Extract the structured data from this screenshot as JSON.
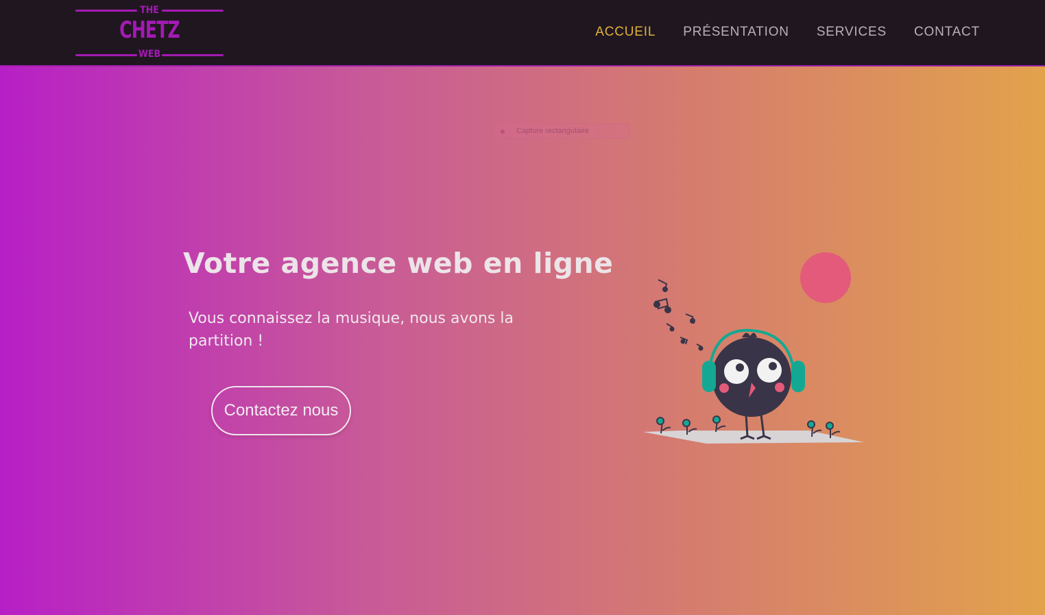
{
  "logo": {
    "top": "THE",
    "main": "CHETZ",
    "bottom": "WEB"
  },
  "nav": {
    "items": [
      {
        "label": "ACCUEIL"
      },
      {
        "label": "PRÉSENTATION"
      },
      {
        "label": "SERVICES"
      },
      {
        "label": "CONTACT"
      }
    ]
  },
  "overlay": {
    "snip_label": "Capture rectangulaire"
  },
  "hero": {
    "title": "Votre agence web en ligne",
    "subtitle": "Vous connaissez la musique, nous avons la partition !",
    "cta_label": "Contactez nous"
  },
  "colors": {
    "header_bg": "#201620",
    "accent_purple": "#a31ab4",
    "active_nav": "#e0b23a",
    "gradient_start": "#b71fc6",
    "gradient_end": "#e2a24c"
  },
  "icons": {
    "illustration": "bird-with-headphones-illustration"
  }
}
